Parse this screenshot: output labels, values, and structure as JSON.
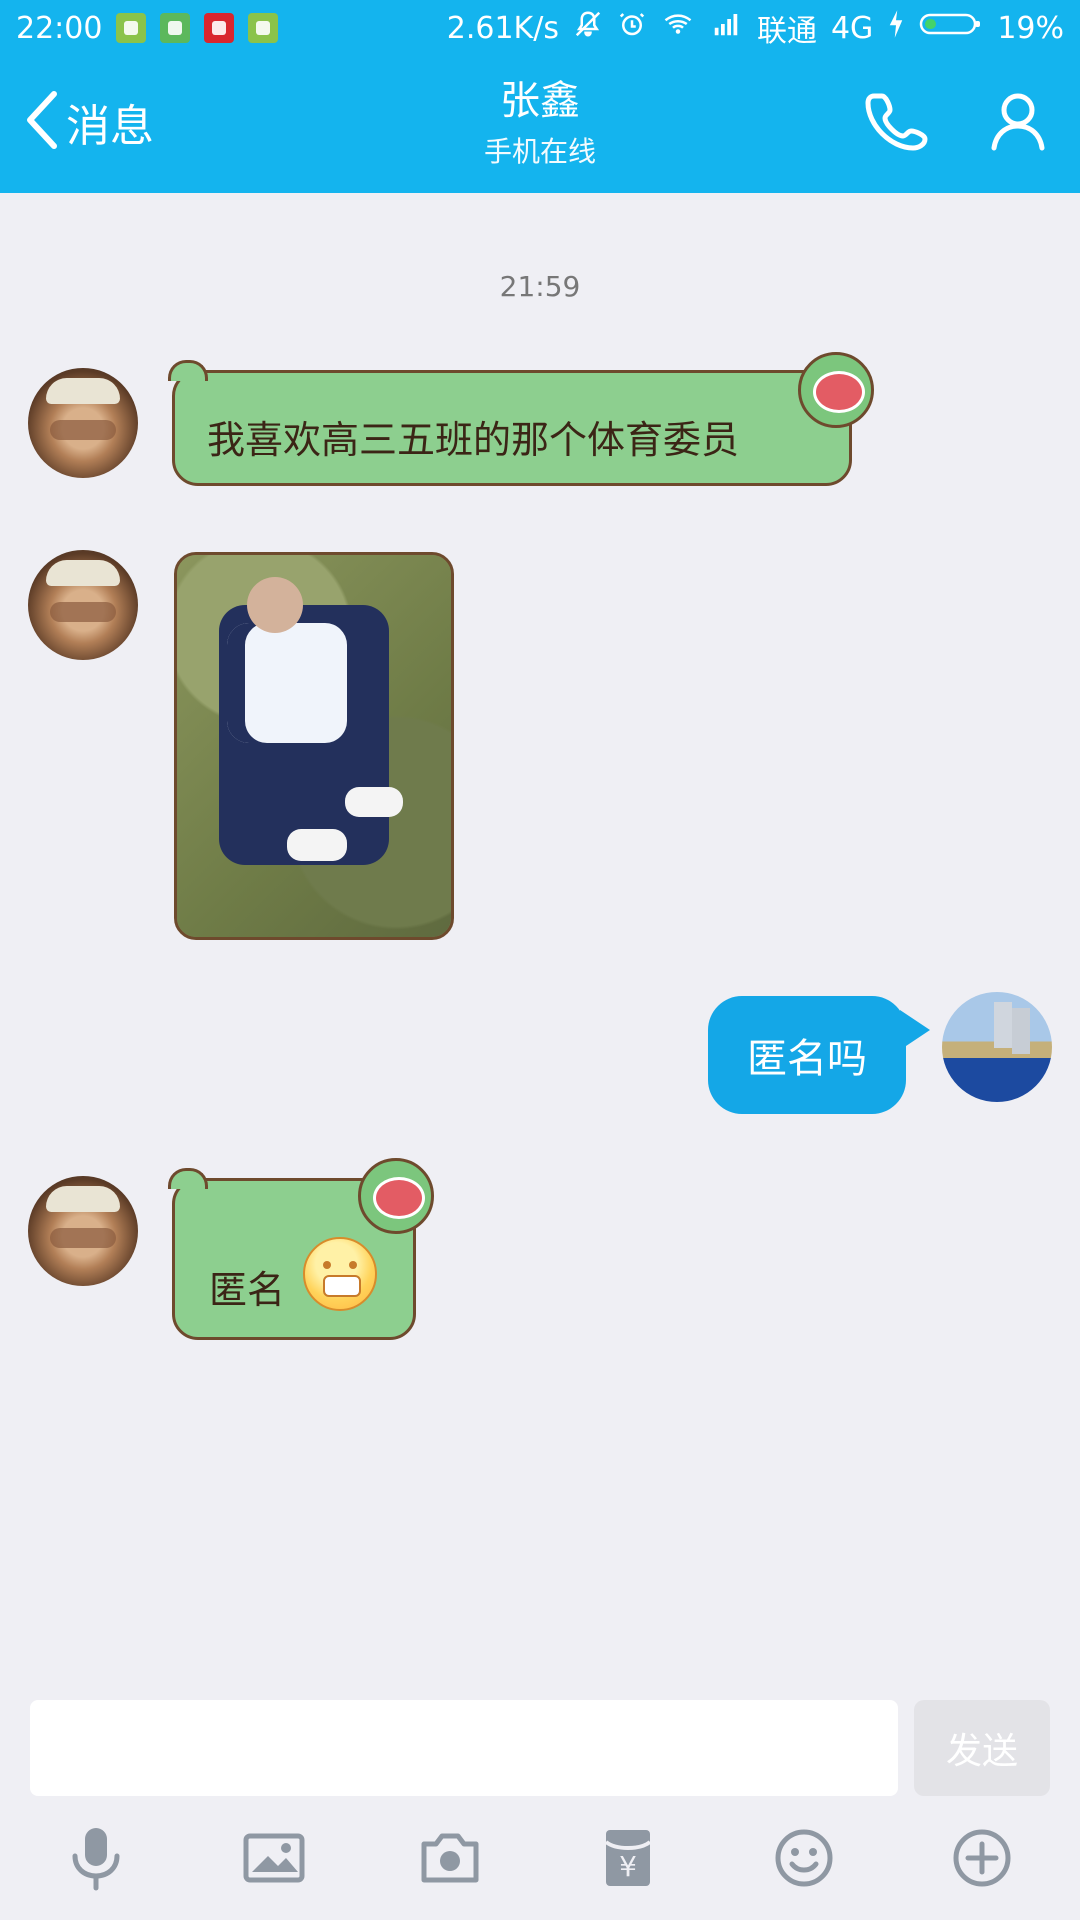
{
  "status_bar": {
    "time": "22:00",
    "network_speed": "2.61K/s",
    "carrier": "联通",
    "network_type": "4G",
    "battery": "19%"
  },
  "header": {
    "back_label": "消息",
    "contact_name": "张鑫",
    "contact_status": "手机在线",
    "icons": [
      "phone-icon",
      "profile-icon"
    ]
  },
  "chat": {
    "timestamp": "21:59",
    "messages": [
      {
        "side": "left",
        "type": "text",
        "text": "我喜欢高三五班的那个体育委员"
      },
      {
        "side": "left",
        "type": "image"
      },
      {
        "side": "right",
        "type": "text",
        "text": "匿名吗"
      },
      {
        "side": "left",
        "type": "text",
        "text": "匿名",
        "emoji": "grin-emoji"
      }
    ]
  },
  "composer": {
    "input_value": "",
    "input_placeholder": "",
    "send_label": "发送",
    "tools": [
      "microphone-icon",
      "image-icon",
      "camera-icon",
      "red-packet-icon",
      "emoji-icon",
      "plus-icon"
    ]
  },
  "colors": {
    "header_bg": "#14b4ee",
    "bubble_blue": "#14a7e7",
    "bubble_green": "#8dcf8f",
    "chat_bg": "#efeff4"
  }
}
